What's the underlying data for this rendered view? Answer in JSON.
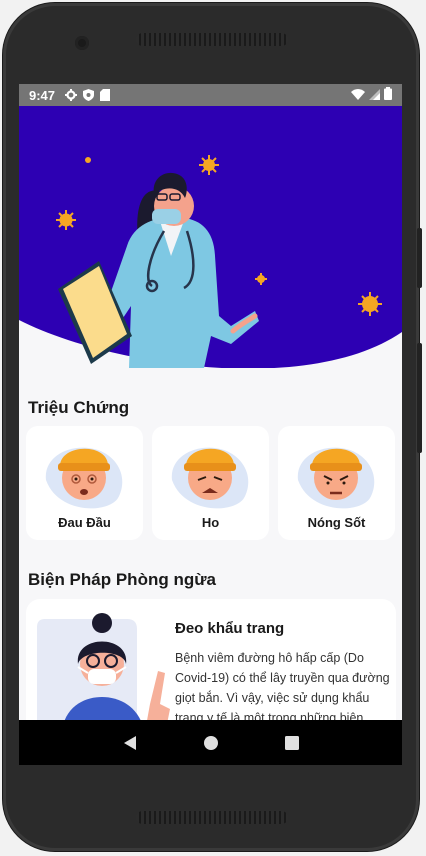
{
  "status_bar": {
    "time": "9:47",
    "left_icons": [
      "settings-icon",
      "shield-icon",
      "sd-card-icon"
    ],
    "right_icons": [
      "wifi-icon",
      "signal-icon",
      "battery-icon"
    ]
  },
  "colors": {
    "hero_background": "#2d00b3",
    "virus": "#f5a623",
    "card_background": "#ffffff",
    "page_background": "#f7f7f9",
    "navbar": "#000000"
  },
  "symptoms": {
    "title": "Triệu Chứng",
    "items": [
      {
        "label": "Đau Đầu",
        "icon": "headache-face-icon"
      },
      {
        "label": "Ho",
        "icon": "cough-face-icon"
      },
      {
        "label": "Nóng Sốt",
        "icon": "fever-face-icon"
      }
    ]
  },
  "prevention": {
    "title": "Biện Pháp Phòng ngừa",
    "items": [
      {
        "title": "Đeo khẩu trang",
        "description": "Bệnh viêm đường hô hấp cấp (Do Covid-19) có thể lây truyền qua đường giọt bắn. Vì vậy, việc sử dụng khẩu trang y tế là một trong những biện",
        "icon": "woman-mask-illustration"
      }
    ]
  },
  "navbar": {
    "buttons": [
      "back-icon",
      "home-icon",
      "recents-icon"
    ]
  }
}
